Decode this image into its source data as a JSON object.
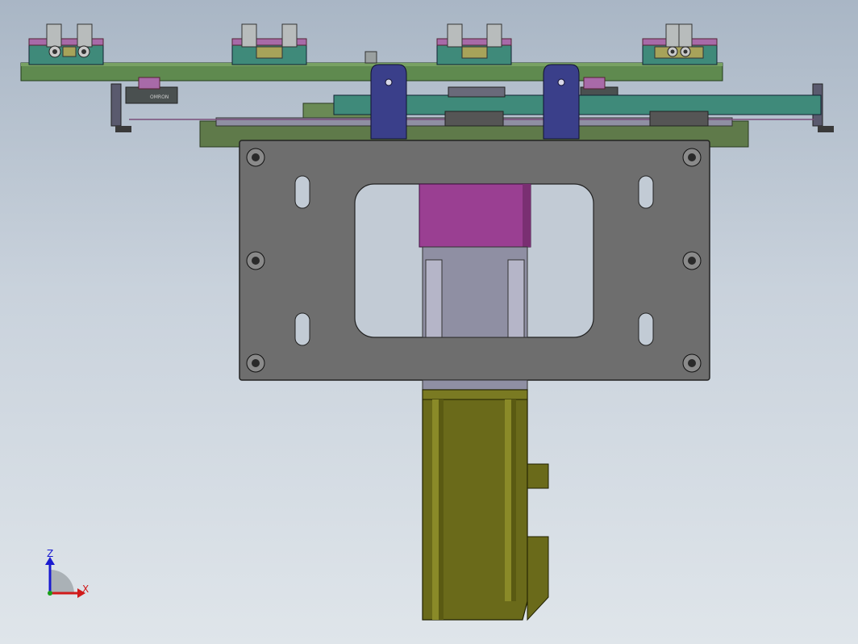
{
  "viewport": {
    "background_top": "#a9b6c5",
    "background_bottom": "#dfe5ea"
  },
  "parts": {
    "top_rail_color": "#5f8a4f",
    "clamp_block_color": "#3f8a7a",
    "clamp_cap_color": "#a86aa8",
    "clamp_insert_color": "#a7a35a",
    "bracket_color": "#3a3f8a",
    "mount_plate_color": "#6e6e6e",
    "motor_housing_color": "#9a3f92",
    "motor_body_color": "#6a6a1a",
    "slide_color": "#8f8fa3"
  },
  "labels": {
    "sensor_text": "OMRON"
  },
  "triad": {
    "z_label": "Z",
    "x_label": "X",
    "z_color": "#1a1ad0",
    "x_color": "#d01a1a"
  }
}
